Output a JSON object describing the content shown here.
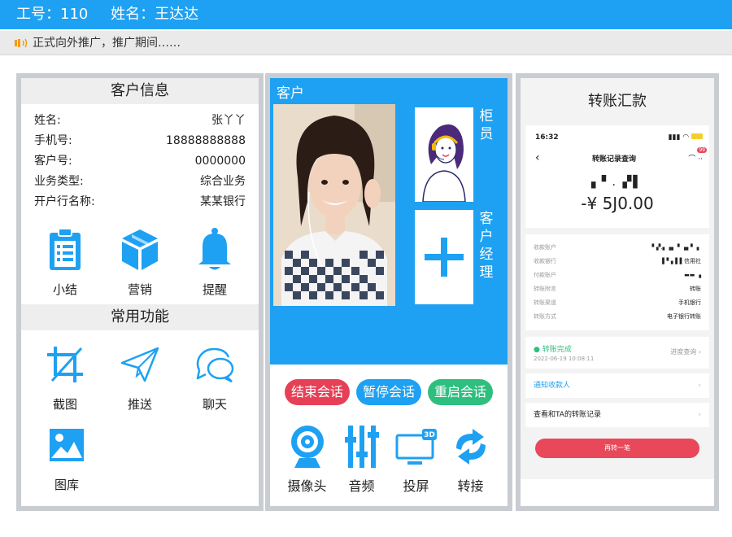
{
  "topbar": {
    "id_label": "工号：110",
    "name_label": "姓名：王达达"
  },
  "notice": {
    "text": "正式向外推广，推广期间……"
  },
  "customer_info": {
    "title": "客户信息",
    "rows": [
      {
        "label": "姓名:",
        "value": "张丫丫"
      },
      {
        "label": "手机号:",
        "value": "18888888888"
      },
      {
        "label": "客户号:",
        "value": "0000000"
      },
      {
        "label": "业务类型:",
        "value": "综合业务"
      },
      {
        "label": "开户行名称:",
        "value": "某某银行"
      }
    ],
    "actions": [
      {
        "label": "小结",
        "icon": "clipboard-icon"
      },
      {
        "label": "营销",
        "icon": "box-icon"
      },
      {
        "label": "提醒",
        "icon": "bell-icon"
      }
    ]
  },
  "common_functions": {
    "title": "常用功能",
    "items": [
      {
        "label": "截图",
        "icon": "crop-icon"
      },
      {
        "label": "推送",
        "icon": "paper-plane-icon"
      },
      {
        "label": "聊天",
        "icon": "chat-icon"
      },
      {
        "label": "图库",
        "icon": "image-icon"
      }
    ]
  },
  "video": {
    "title": "客户",
    "teller_label": "柜员",
    "manager_label": "客户经理",
    "buttons": [
      {
        "label": "结束会话",
        "color": "#e64057"
      },
      {
        "label": "暂停会话",
        "color": "#1ea1f2"
      },
      {
        "label": "重启会话",
        "color": "#2ebf7f"
      }
    ],
    "tools": [
      {
        "label": "摄像头",
        "icon": "webcam-icon"
      },
      {
        "label": "音频",
        "icon": "equalizer-icon"
      },
      {
        "label": "投屏",
        "icon": "screen-3d-icon"
      },
      {
        "label": "转接",
        "icon": "transfer-icon"
      }
    ]
  },
  "transfer": {
    "title": "转账汇款",
    "time": "16:32",
    "badge": "99",
    "nav_title": "转账记录查询",
    "payee_blur": "▖▘. ▞▌",
    "amount": "-¥ 5J0.00",
    "details": [
      {
        "k": "收款账户",
        "v": "▘▞.▖▗▖ ▘▗▖▘  ▖"
      },
      {
        "k": "收款银行",
        "v": "▌▘▖▌▌信用社"
      },
      {
        "k": "付款账户",
        "v": "▬▬        ▗"
      },
      {
        "k": "转账附言",
        "v": "转账"
      },
      {
        "k": "转账渠道",
        "v": "手机银行"
      },
      {
        "k": "转账方式",
        "v": "电子银行转账"
      }
    ],
    "status": "● 转账完成",
    "status_time": "2022-06-19 10:08:11",
    "progress_link": "进度查询 ›",
    "notify": "通知收款人",
    "records": "查看和TA的转账记录",
    "again": "再转一笔",
    "colors": {
      "accent": "#1ea1f2",
      "success": "#2ebf7f",
      "danger": "#e8485a"
    }
  }
}
